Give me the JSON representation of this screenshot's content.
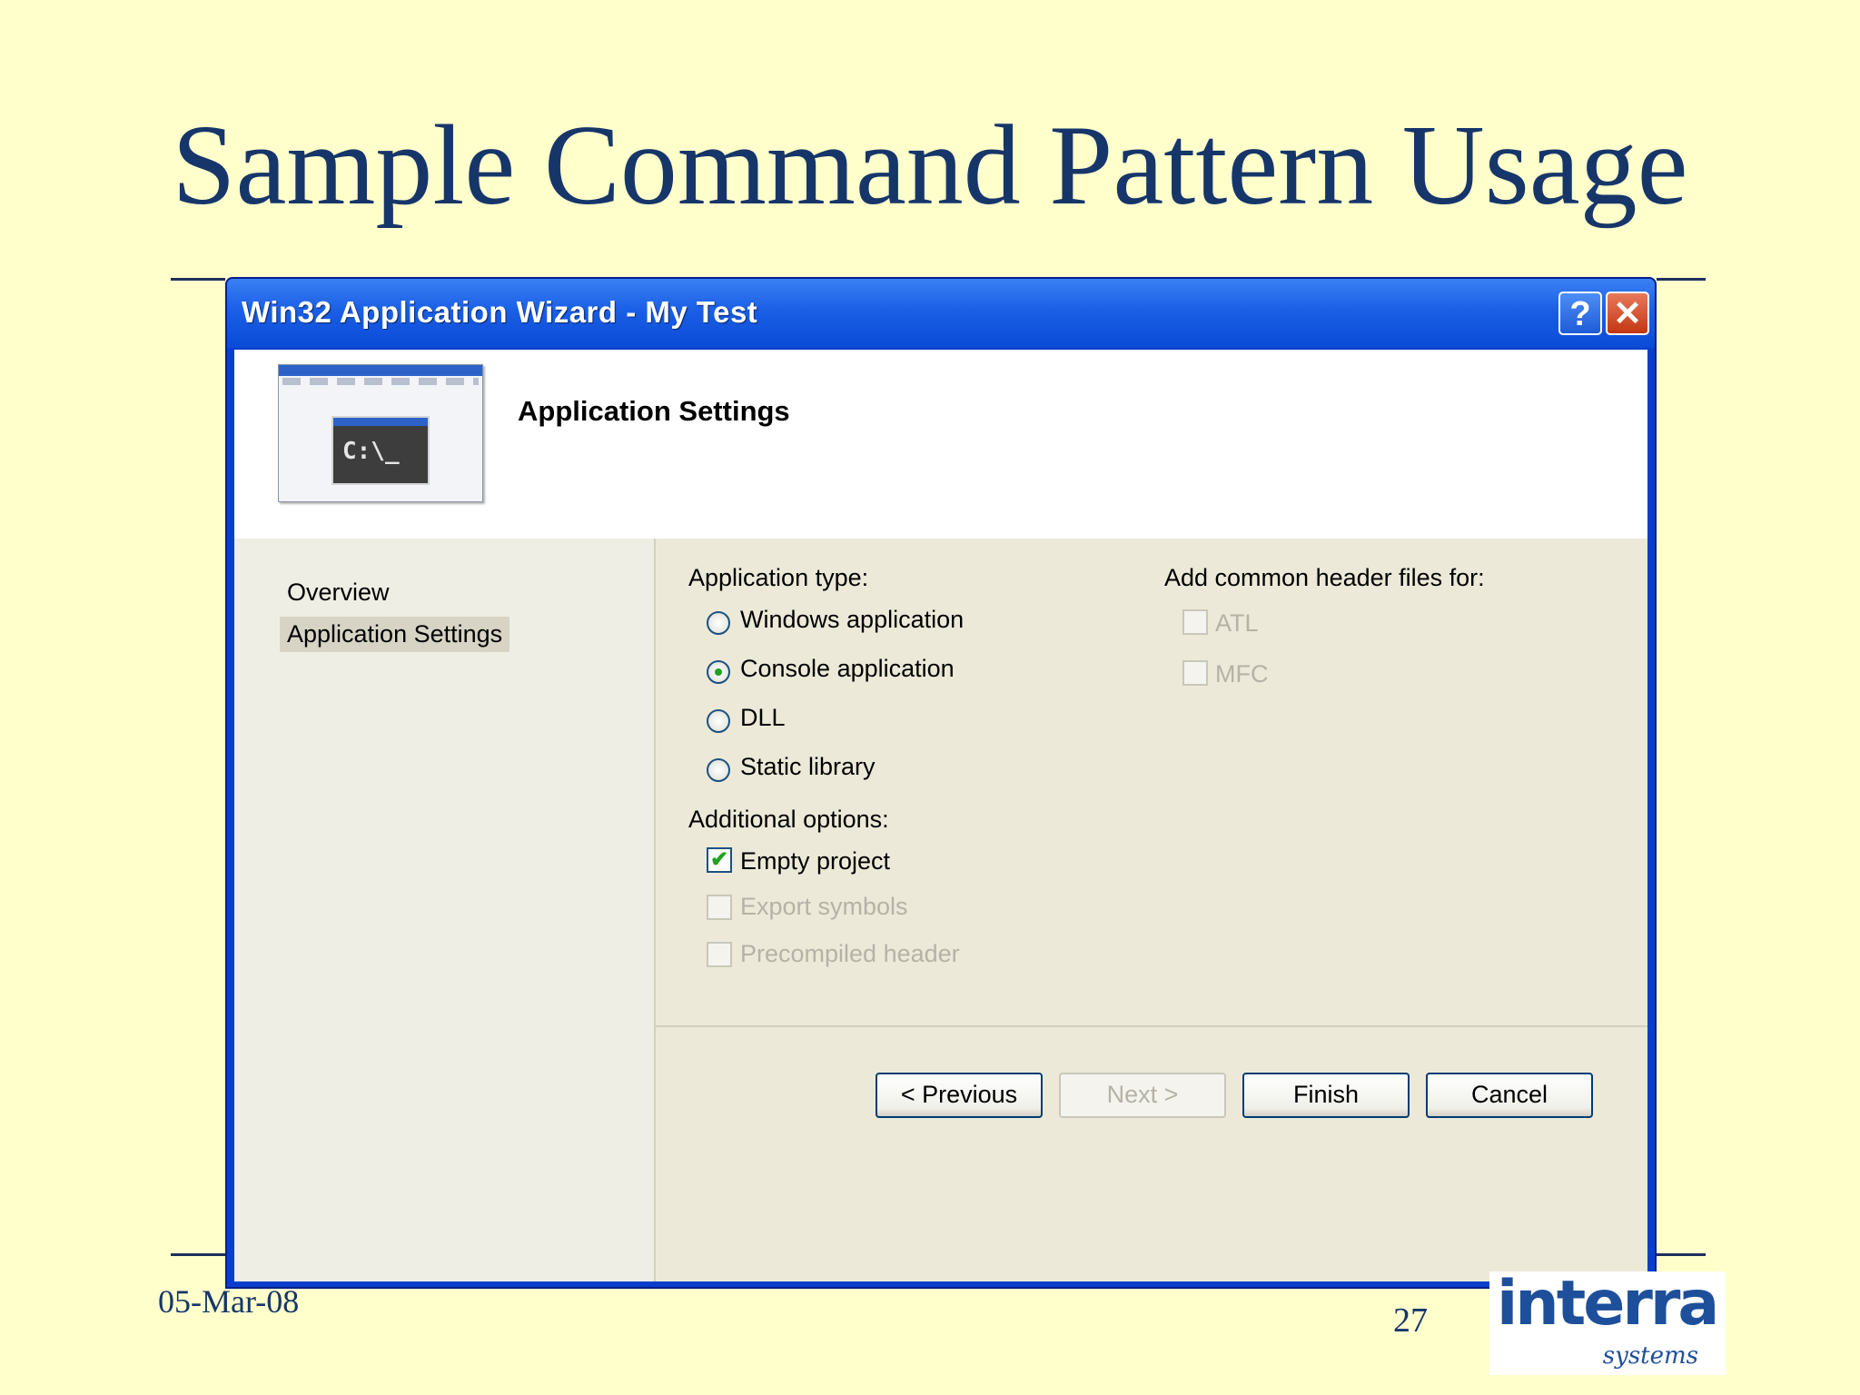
{
  "slide": {
    "title": "Sample Command Pattern Usage",
    "date": "05-Mar-08",
    "page_number": "27",
    "logo_main": "interra",
    "logo_sub": "systems"
  },
  "dialog": {
    "title": "Win32 Application Wizard - My Test",
    "help_label": "?",
    "close_label": "✕",
    "header_title": "Application Settings",
    "thumbnail_prompt": "C:\\_",
    "nav": [
      {
        "label": "Overview",
        "selected": false
      },
      {
        "label": "Application Settings",
        "selected": true
      }
    ],
    "application_type": {
      "label": "Application type:",
      "options": [
        {
          "label": "Windows application",
          "selected": false
        },
        {
          "label": "Console application",
          "selected": true
        },
        {
          "label": "DLL",
          "selected": false
        },
        {
          "label": "Static library",
          "selected": false
        }
      ]
    },
    "additional_options": {
      "label": "Additional options:",
      "options": [
        {
          "label": "Empty project",
          "checked": true,
          "enabled": true
        },
        {
          "label": "Export symbols",
          "checked": false,
          "enabled": false
        },
        {
          "label": "Precompiled header",
          "checked": false,
          "enabled": false
        }
      ]
    },
    "header_files": {
      "label": "Add common header files for:",
      "options": [
        {
          "label": "ATL",
          "checked": false,
          "enabled": false
        },
        {
          "label": "MFC",
          "checked": false,
          "enabled": false
        }
      ]
    },
    "buttons": {
      "previous": "< Previous",
      "next": "Next >",
      "finish": "Finish",
      "cancel": "Cancel"
    },
    "check_mark": "✔"
  },
  "colors": {
    "slide_background": "#FFFFCC",
    "title_color": "#16366A",
    "titlebar_blue": "#0B4BD6",
    "dialog_face": "#ECE9D8"
  }
}
